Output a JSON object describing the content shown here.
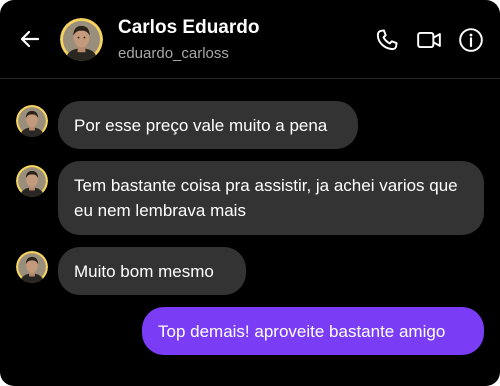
{
  "header": {
    "contact_name": "Carlos Eduardo",
    "contact_username": "eduardo_carloss"
  },
  "icons": {
    "back": "arrow-left-icon",
    "call": "phone-icon",
    "video": "video-camera-icon",
    "info": "info-icon"
  },
  "colors": {
    "background": "#000000",
    "incoming_bubble": "#333333",
    "outgoing_bubble": "#7a3df5",
    "avatar_ring": "#f4d35e"
  },
  "messages": [
    {
      "direction": "incoming",
      "text": "Por esse preço vale muito a pena"
    },
    {
      "direction": "incoming",
      "text": "Tem bastante coisa pra assistir, ja achei varios que eu nem lembrava mais"
    },
    {
      "direction": "incoming",
      "text": "Muito bom mesmo"
    },
    {
      "direction": "outgoing",
      "text": "Top demais! aproveite bastante amigo"
    }
  ]
}
